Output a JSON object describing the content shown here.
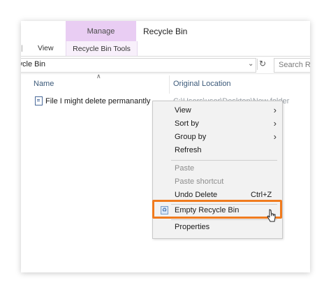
{
  "ribbon": {
    "manage_tab": "Manage",
    "window_title": "Recycle Bin",
    "view_tab": "View",
    "context_tab": "Recycle Bin Tools"
  },
  "address": {
    "path": "cycle Bin",
    "search_placeholder": "Search Re"
  },
  "columns": {
    "name": "Name",
    "original_location": "Original Location"
  },
  "file": {
    "name": "File I might delete permanantly",
    "original_location": "C:\\Users\\user\\Desktop\\New folder"
  },
  "menu": {
    "items": [
      {
        "label": "View",
        "submenu": true
      },
      {
        "label": "Sort by",
        "submenu": true
      },
      {
        "label": "Group by",
        "submenu": true
      },
      {
        "label": "Refresh"
      },
      {
        "label": "Paste",
        "disabled": true
      },
      {
        "label": "Paste shortcut",
        "disabled": true
      },
      {
        "label": "Undo Delete",
        "shortcut": "Ctrl+Z"
      },
      {
        "label": "Empty Recycle Bin",
        "icon": "recycle-bin-icon",
        "highlighted": true
      },
      {
        "label": "Properties"
      }
    ]
  },
  "colors": {
    "context_tab": "#e9cdf3",
    "highlight": "#f07b1e"
  }
}
